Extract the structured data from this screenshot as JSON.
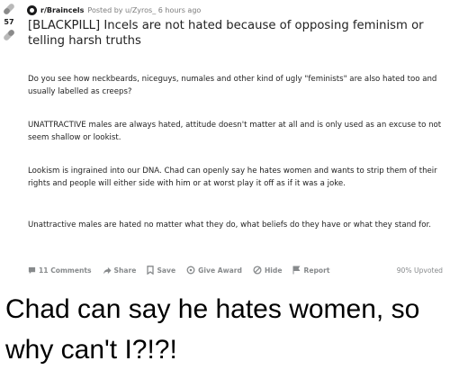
{
  "post": {
    "subreddit": "r/Braincels",
    "posted_by": "Posted by u/Zyros_",
    "time_ago": "6 hours ago",
    "vote_count": "57",
    "title": "[BLACKPILL] Incels are not hated because of opposing feminism or telling harsh truths",
    "paragraphs": [
      "Do you see how neckbeards, niceguys, numales and other kind of ugly \"feminists\" are also hated too and usually labelled as creeps?",
      "UNATTRACTIVE males are always hated, attitude doesn't matter at all and is only used as an excuse to not seem shallow or lookist.",
      "Lookism is ingrained into our DNA. Chad can openly say he hates women and wants to strip them of their rights and people will either side with him or at worst play it off as if it was a joke.",
      "Unattractive males are hated no matter what they do, what beliefs do they have or what they stand for."
    ]
  },
  "actions": {
    "comments": "11 Comments",
    "share": "Share",
    "save": "Save",
    "give_award": "Give Award",
    "hide": "Hide",
    "report": "Report",
    "upvoted": "90% Upvoted"
  },
  "caption": "Chad can say he hates women, so why can't I?!?!",
  "icons": {
    "upvote": "pill-icon",
    "downvote": "pill-icon",
    "subreddit": "subreddit-icon",
    "comments": "comment-icon",
    "share": "share-icon",
    "save": "bookmark-icon",
    "award": "award-icon",
    "hide": "hide-icon",
    "report": "flag-icon"
  },
  "colors": {
    "meta_gray": "#878a8c",
    "text": "#222222"
  }
}
